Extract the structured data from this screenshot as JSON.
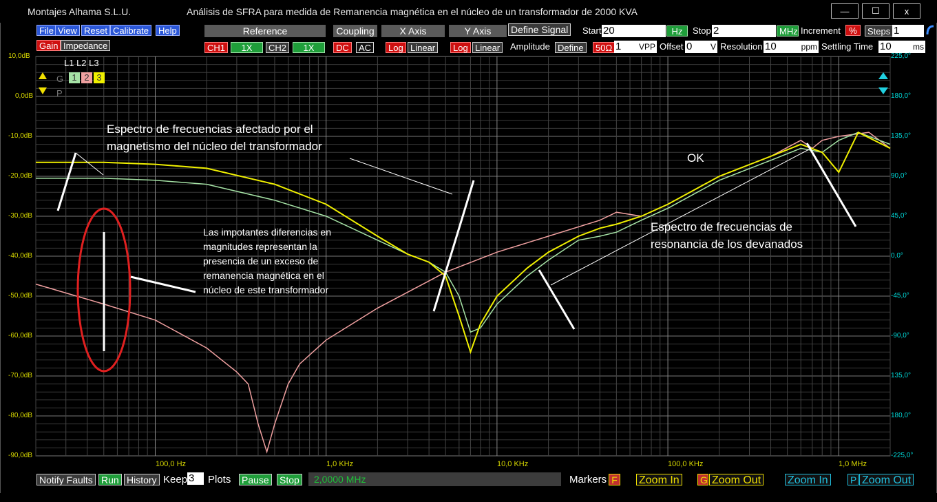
{
  "window": {
    "app_title": "Montajes Alhama S.L.U.",
    "doc_title": "Análisis de SFRA para medida de Remanencia magnética en el núcleo de un transformador de 2000 KVA",
    "minimize": "—",
    "maximize": "☐",
    "close": "x"
  },
  "menu": [
    "File",
    "View",
    "Reset",
    "Calibrate",
    "Help"
  ],
  "mode": {
    "gain": "Gain",
    "impedance": "Impedance"
  },
  "headers": {
    "reference": "Reference",
    "coupling": "Coupling",
    "x_axis": "X Axis",
    "y_axis": "Y Axis",
    "define_signal": "Define Signal"
  },
  "reference": {
    "ch1": "CH1",
    "ch1_gain": "1X",
    "ch2": "CH2",
    "ch2_gain": "1X"
  },
  "coupling": {
    "dc": "DC",
    "ac": "AC"
  },
  "x_axis": {
    "log": "Log",
    "linear": "Linear"
  },
  "y_axis": {
    "log": "Log",
    "linear": "Linear"
  },
  "signal": {
    "amplitude_label": "Amplitude",
    "define": "Define",
    "ohm": "50Ω",
    "amplitude_value": "1",
    "amplitude_unit": "VPP",
    "offset_label": "Offset",
    "offset_value": "0",
    "offset_unit": "V",
    "resolution_label": "Resolution",
    "resolution_value": "10",
    "resolution_unit": "ppm",
    "settling_label": "Settling Time",
    "settling_value": "10",
    "settling_unit": "ms",
    "start_label": "Start",
    "start_value": "20",
    "start_unit": "Hz",
    "stop_label": "Stop",
    "stop_value": "2",
    "stop_unit": "MHz",
    "increment_label": "Increment",
    "increment_unit": "%",
    "steps_label": "Steps",
    "steps_value": "1"
  },
  "legend": {
    "lines": "L1 L2 L3",
    "g": "G",
    "p": "P",
    "l1": "1",
    "l2": "2",
    "l3": "3"
  },
  "colors": {
    "l1": "#a6e3a6",
    "l2": "#f0a0a0",
    "l3": "#f0f000",
    "axis_left": "#d8d800",
    "axis_right": "#00d8d8"
  },
  "chart_data": {
    "type": "line",
    "x_scale": "log",
    "xlim": [
      20,
      2000000
    ],
    "x_ticks": [
      "100,0 Hz",
      "1,0 KHz",
      "10,0 KHz",
      "100,0 KHz",
      "1,0 MHz"
    ],
    "y_ticks": [
      "10,0dB",
      "0,0dB",
      "-10,0dB",
      "-20,0dB",
      "-30,0dB",
      "-40,0dB",
      "-50,0dB",
      "-60,0dB",
      "-70,0dB",
      "-80,0dB",
      "-90,0dB"
    ],
    "ylim": [
      -90,
      10
    ],
    "y2_ticks": [
      "225,0°",
      "180,0°",
      "135,0°",
      "90,0°",
      "45,0°",
      "0,0°",
      "-45,0°",
      "-90,0°",
      "135,0°",
      "180,0°",
      "-225,0°"
    ],
    "series": [
      {
        "name": "1",
        "color": "#a6e3a6",
        "x": [
          20,
          50,
          100,
          200,
          500,
          1000,
          2000,
          3000,
          4000,
          5000,
          6000,
          7000,
          8000,
          10000,
          15000,
          20000,
          30000,
          40000,
          50000,
          70000,
          100000,
          200000,
          400000,
          600000,
          800000,
          1000000,
          1300000,
          2000000
        ],
        "values": [
          -20.5,
          -20.5,
          -21,
          -22,
          -26,
          -30,
          -36,
          -39.5,
          -41.5,
          -44,
          -50,
          -59,
          -58,
          -52,
          -45,
          -41,
          -36,
          -35,
          -34,
          -31,
          -28,
          -21,
          -16,
          -13,
          -14,
          -11,
          -9,
          -12
        ]
      },
      {
        "name": "2",
        "color": "#f0a0a0",
        "x": [
          20,
          50,
          100,
          200,
          300,
          350,
          400,
          450,
          500,
          600,
          700,
          1000,
          2000,
          5000,
          10000,
          20000,
          40000,
          50000,
          70000,
          100000,
          200000,
          400000,
          600000,
          700000,
          800000,
          1000000,
          1500000,
          2000000
        ],
        "values": [
          -47,
          -52,
          -56,
          -63,
          -69,
          -72,
          -82,
          -89,
          -82,
          -72,
          -67,
          -61,
          -53,
          -44,
          -39,
          -35,
          -31,
          -29,
          -30,
          -27,
          -20,
          -15,
          -11,
          -13,
          -11,
          -10,
          -9,
          -13
        ]
      },
      {
        "name": "3",
        "color": "#f0f000",
        "x": [
          20,
          50,
          100,
          200,
          500,
          1000,
          2000,
          3000,
          4000,
          5000,
          6000,
          7000,
          8000,
          10000,
          15000,
          20000,
          30000,
          40000,
          50000,
          70000,
          100000,
          200000,
          400000,
          600000,
          800000,
          1000000,
          1300000,
          2000000
        ],
        "values": [
          -16.5,
          -16.5,
          -17,
          -18,
          -22,
          -27,
          -35,
          -39.5,
          -41.5,
          -45,
          -55,
          -64,
          -57,
          -50,
          -43,
          -39,
          -35,
          -33,
          -32,
          -30,
          -27,
          -20,
          -15,
          -12,
          -14,
          -19,
          -9,
          -13
        ]
      }
    ]
  },
  "annotations": {
    "a1_line1": "Espectro de frecuencias afectado por el",
    "a1_line2": "magnetismo del núcleo del transformador",
    "a2_line1": "Las impotantes diferencias en",
    "a2_line2": "magnitudes representan la",
    "a2_line3": "presencia de un exceso de",
    "a2_line4": "remanencia magnética en el",
    "a2_line5": "núcleo de este transformador",
    "ok": "OK",
    "a3_line1": "Espectro de frecuencias de",
    "a3_line2": "resonancia de los devanados"
  },
  "bottom": {
    "notify": "Notify Faults",
    "run": "Run",
    "history": "History",
    "keep": "Keep",
    "keep_value": "3",
    "plots": "Plots",
    "pause": "Pause",
    "stop": "Stop",
    "status": "2,0000 MHz",
    "markers": "Markers",
    "markers_f": "F",
    "zoom_in_g": "Zoom In",
    "g": "G",
    "zoom_out_g": "Zoom Out",
    "zoom_in_p": "Zoom In",
    "p": "P",
    "zoom_out_p": "Zoom Out"
  }
}
